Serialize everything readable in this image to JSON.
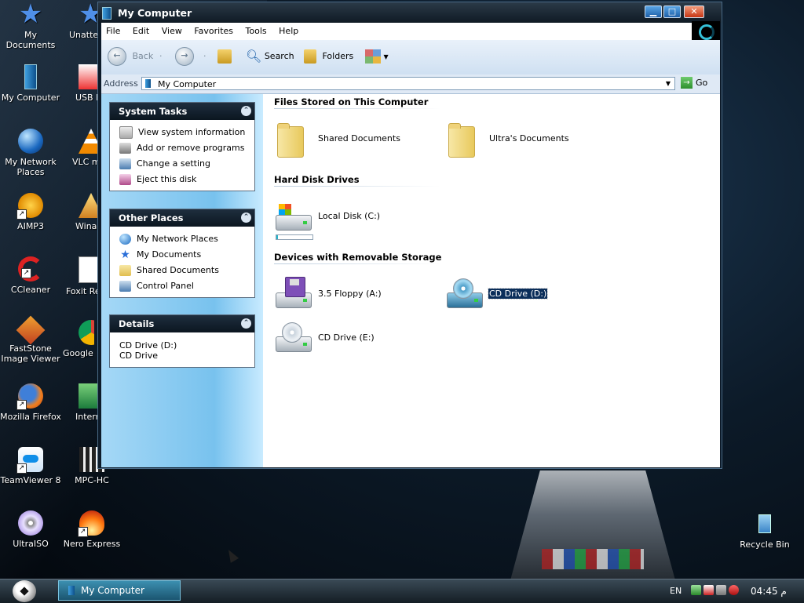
{
  "desktop": {
    "icons_left": [
      {
        "label": "My Documents"
      },
      {
        "label": "My Computer"
      },
      {
        "label": "My Network Places"
      },
      {
        "label": "AIMP3"
      },
      {
        "label": "CCleaner"
      },
      {
        "label": "FastStone Image Viewer"
      },
      {
        "label": "Mozilla Firefox"
      },
      {
        "label": "TeamViewer 8"
      },
      {
        "label": "UltraISO"
      }
    ],
    "icons_second": [
      {
        "label": "Unatte Sof"
      },
      {
        "label": "USB D secu"
      },
      {
        "label": "VLC m playe"
      },
      {
        "label": "Wina"
      },
      {
        "label": "Foxit Re"
      },
      {
        "label": "Google C"
      },
      {
        "label": "Intern Downl"
      },
      {
        "label": "MPC-HC"
      },
      {
        "label": "Nero Express"
      }
    ],
    "recycle_bin": "Recycle Bin"
  },
  "window": {
    "title": "My Computer",
    "buttons": {
      "minimize": "minimize-icon",
      "maximize": "maximize-icon",
      "close": "close-icon"
    },
    "menu": [
      "File",
      "Edit",
      "View",
      "Favorites",
      "Tools",
      "Help"
    ],
    "toolbar": {
      "back": "Back",
      "search": "Search",
      "folders": "Folders"
    },
    "address": {
      "label": "Address",
      "value": "My Computer",
      "go": "Go"
    }
  },
  "left_pane": {
    "system_tasks": {
      "title": "System Tasks",
      "items": [
        "View system information",
        "Add or remove programs",
        "Change a setting",
        "Eject this disk"
      ]
    },
    "other_places": {
      "title": "Other Places",
      "items": [
        "My Network Places",
        "My Documents",
        "Shared Documents",
        "Control Panel"
      ]
    },
    "details": {
      "title": "Details",
      "name": "CD Drive (D:)",
      "type": "CD Drive"
    }
  },
  "content": {
    "groups": [
      {
        "title": "Files Stored on This Computer",
        "items": [
          "Shared Documents",
          "Ultra's Documents"
        ]
      },
      {
        "title": "Hard Disk Drives",
        "items": [
          "Local Disk (C:)"
        ]
      },
      {
        "title": "Devices with Removable Storage",
        "items": [
          "3.5 Floppy (A:)",
          "CD Drive (D:)",
          "CD Drive (E:)"
        ]
      }
    ],
    "local_disk_usage": 0.05,
    "selected_item": "CD Drive (D:)"
  },
  "taskbar": {
    "task": "My Computer",
    "language": "EN",
    "clock": "04:45 م"
  },
  "colors": {
    "accent": "#0b2e5a",
    "leftpane": "#78c2ee",
    "titlebar": "#0f1a24"
  }
}
